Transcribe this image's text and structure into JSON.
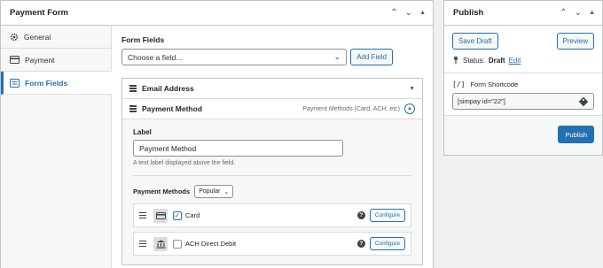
{
  "payment_form": {
    "title": "Payment Form",
    "tabs": [
      {
        "label": "General",
        "icon": "gear-icon"
      },
      {
        "label": "Payment",
        "icon": "credit-card-icon"
      },
      {
        "label": "Form Fields",
        "icon": "form-fields-icon",
        "active": true
      }
    ],
    "form_fields_label": "Form Fields",
    "choose_field_placeholder": "Choose a field...",
    "add_field_label": "Add Field",
    "fields": [
      {
        "title": "Email Address"
      },
      {
        "title": "Payment Method",
        "subtitle": "Payment Methods (Card, ACH, etc)"
      }
    ],
    "expanded": {
      "label_heading": "Label",
      "label_value": "Payment Method",
      "label_help": "A text label displayed above the field.",
      "payment_methods_label": "Payment Methods",
      "payment_methods_filter": "Popular",
      "methods": [
        {
          "name": "Card",
          "checked": true,
          "icon": "credit-card-icon",
          "configure": "Configure"
        },
        {
          "name": "ACH Direct Debit",
          "checked": false,
          "icon": "bank-icon",
          "configure": "Configure"
        }
      ]
    }
  },
  "publish": {
    "title": "Publish",
    "save_draft": "Save Draft",
    "preview": "Preview",
    "status_label": "Status:",
    "status_value": "Draft",
    "status_edit": "Edit",
    "shortcode_label": "Form Shortcode",
    "shortcode_value": "[simpay id=\"22\"]",
    "publish_button": "Publish"
  },
  "colors": {
    "accent": "#2271b1",
    "border": "#c3c4c7",
    "background": "#f0f0f1"
  }
}
